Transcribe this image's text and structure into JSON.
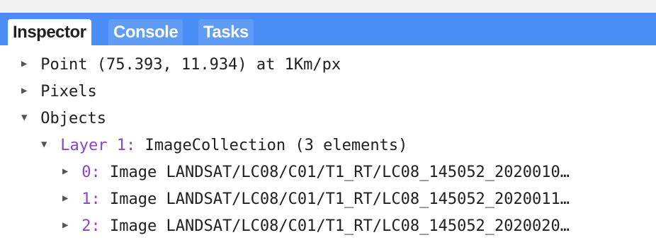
{
  "tabs": [
    {
      "label": "Inspector",
      "active": true
    },
    {
      "label": "Console",
      "active": false
    },
    {
      "label": "Tasks",
      "active": false
    }
  ],
  "tree": {
    "point": {
      "expanded": false,
      "text": "Point (75.393, 11.934) at 1Km/px"
    },
    "pixels": {
      "expanded": false,
      "text": "Pixels"
    },
    "objects": {
      "expanded": true,
      "text": "Objects"
    },
    "layer": {
      "expanded": true,
      "key": "Layer 1:",
      "text": "ImageCollection (3 elements)"
    },
    "images": [
      {
        "expanded": false,
        "key": "0:",
        "text": "Image LANDSAT/LC08/C01/T1_RT/LC08_145052_2020010…"
      },
      {
        "expanded": false,
        "key": "1:",
        "text": "Image LANDSAT/LC08/C01/T1_RT/LC08_145052_2020011…"
      },
      {
        "expanded": false,
        "key": "2:",
        "text": "Image LANDSAT/LC08/C01/T1_RT/LC08_145052_2020020…"
      }
    ]
  },
  "colors": {
    "tab_bar": "#4a8ef5",
    "inactive_tab": "#5f9cf7",
    "key_purple": "#8e44c6"
  },
  "icons": {
    "collapsed": "triangle-right-icon",
    "expanded": "triangle-down-icon"
  }
}
